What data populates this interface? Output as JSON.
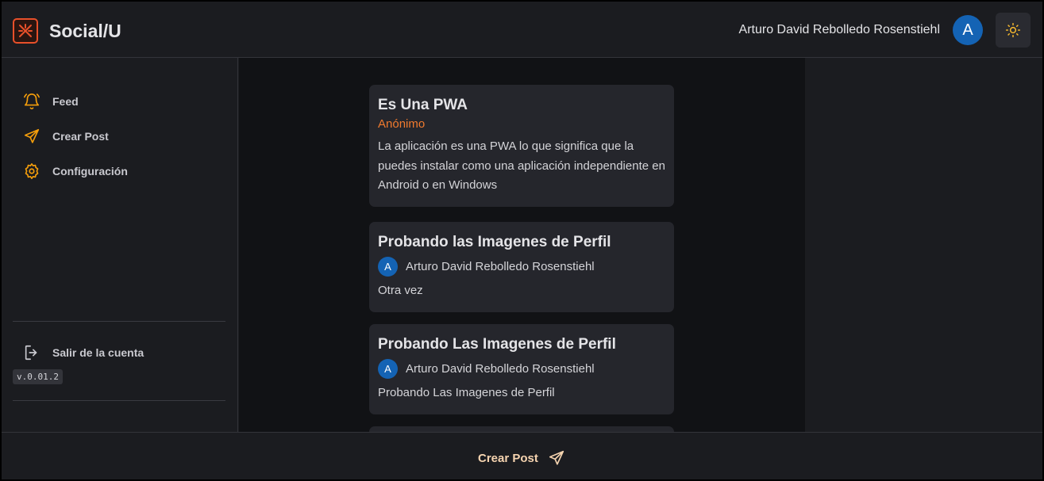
{
  "header": {
    "brand": "Social/U",
    "user_name": "Arturo David Rebolledo Rosenstiehl",
    "avatar_initial": "A",
    "logo_icon": "logo-icon",
    "theme_icon": "sun-icon"
  },
  "sidebar": {
    "items": [
      {
        "label": "Feed",
        "icon": "bell-icon"
      },
      {
        "label": "Crear Post",
        "icon": "send-icon"
      },
      {
        "label": "Configuración",
        "icon": "gear-icon"
      }
    ],
    "logout_label": "Salir de la cuenta",
    "version": "v.0.01.2"
  },
  "posts": [
    {
      "title": "Es Una PWA",
      "author": "Anónimo",
      "body": "La aplicación es una PWA lo que significa que la puedes instalar como una aplicación independiente en Android o en Windows"
    },
    {
      "title": "Probando las Imagenes de Perfil",
      "author_initial": "A",
      "author": "Arturo David Rebolledo Rosenstiehl",
      "body": "Otra vez"
    },
    {
      "title": "Probando Las Imagenes de Perfil",
      "author_initial": "A",
      "author": "Arturo David Rebolledo Rosenstiehl",
      "body": "Probando Las Imagenes de Perfil"
    }
  ],
  "footer": {
    "create_label": "Crear Post"
  },
  "colors": {
    "accent": "#f59e0b",
    "anon": "#f07a2e",
    "avatar": "#1463b4"
  }
}
